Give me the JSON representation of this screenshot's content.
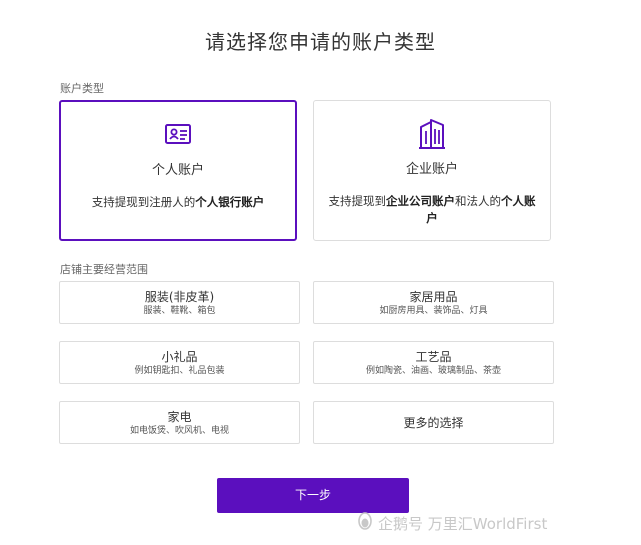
{
  "title": "请选择您申请的账户类型",
  "account_section_label": "账户类型",
  "personal": {
    "title": "个人账户",
    "desc_prefix": "支持提现到注册人的",
    "desc_bold": "个人银行账户"
  },
  "business": {
    "title": "企业账户",
    "desc_prefix": "支持提现到",
    "desc_bold1": "企业公司账户",
    "desc_mid": "和法人的",
    "desc_bold2": "个人账户"
  },
  "scope_section_label": "店铺主要经营范围",
  "scopes": [
    {
      "title": "服装(非皮革)",
      "sub": "服装、鞋靴、箱包"
    },
    {
      "title": "家居用品",
      "sub": "如厨房用具、装饰品、灯具"
    },
    {
      "title": "小礼品",
      "sub": "例如钥匙扣、礼品包装"
    },
    {
      "title": "工艺品",
      "sub": "例如陶瓷、油画、玻璃制品、茶壶"
    },
    {
      "title": "家电",
      "sub": "如电饭煲、吹风机、电视"
    },
    {
      "title": "更多的选择"
    }
  ],
  "next_label": "下一步",
  "watermark": "企鹅号 万里汇WorldFirst",
  "colors": {
    "accent": "#5b0fbe",
    "border": "#dddddd",
    "text": "#333333"
  }
}
